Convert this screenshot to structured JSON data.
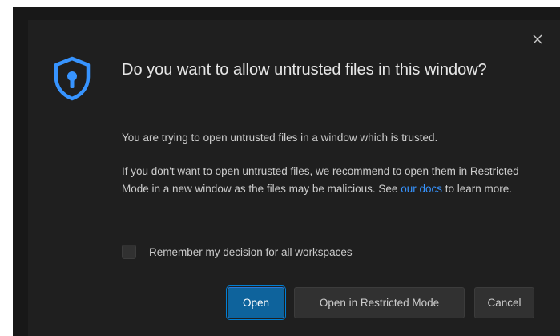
{
  "dialog": {
    "title": "Do you want to allow untrusted files in this window?",
    "message": "You are trying to open untrusted files in a window which is trusted.",
    "detail_before_link": "If you don't want to open untrusted files, we recommend to open them in Restricted Mode in a new window as the files may be malicious. See ",
    "detail_link": "our docs",
    "detail_after_link": " to learn more.",
    "checkbox_label": "Remember my decision for all workspaces",
    "checkbox_checked": false,
    "icon": "shield-lock-icon",
    "close_icon": "close-icon"
  },
  "buttons": {
    "open": "Open",
    "open_restricted": "Open in Restricted Mode",
    "cancel": "Cancel"
  },
  "colors": {
    "accent": "#3794ff",
    "primary_button": "#0e639c",
    "dialog_background": "#1f1f1f"
  }
}
